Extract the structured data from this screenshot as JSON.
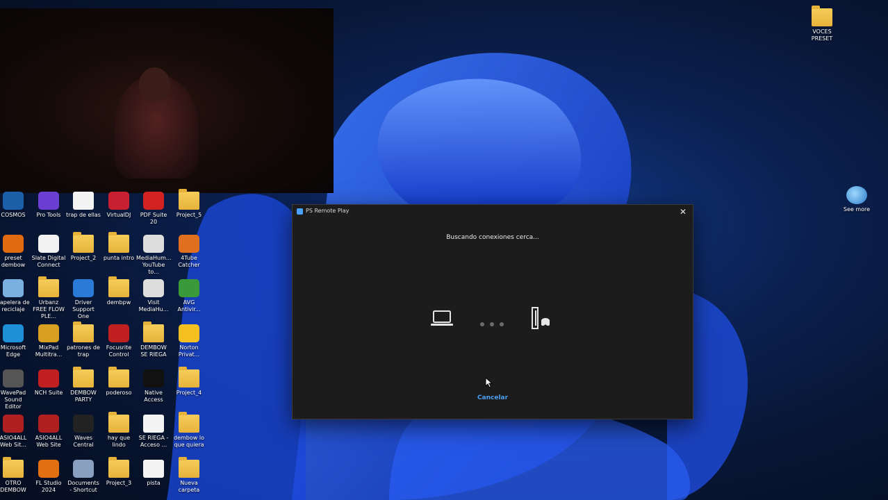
{
  "dialog": {
    "title": "PS Remote Play",
    "status_text": "Buscando conexiones cerca...",
    "cancel_label": "Cancelar",
    "icons": [
      "laptop-icon",
      "connecting-dots-icon",
      "ps5-console-icon",
      "close-icon"
    ]
  },
  "desktop_icons": {
    "top_right": [
      {
        "label": "VOCES PRESET",
        "type": "folder"
      },
      {
        "label": "See more",
        "type": "globe"
      }
    ],
    "row1": [
      {
        "label": "COSMOS",
        "type": "app",
        "color": "#1a5fa8"
      },
      {
        "label": "Pro Tools",
        "type": "app",
        "color": "#6b3fd1"
      },
      {
        "label": "trap de ellas",
        "type": "media"
      },
      {
        "label": "VirtualDJ",
        "type": "app",
        "color": "#c82030"
      },
      {
        "label": "PDF Suite 20",
        "type": "app",
        "color": "#d42222"
      },
      {
        "label": "Project_5",
        "type": "folder"
      }
    ],
    "row2": [
      {
        "label": "preset dembow",
        "type": "app",
        "color": "#e06a10"
      },
      {
        "label": "Slate Digital Connect",
        "type": "app",
        "color": "#f2f2f2"
      },
      {
        "label": "Project_2",
        "type": "folder"
      },
      {
        "label": "punta intro",
        "type": "folder"
      },
      {
        "label": "MediaHum... YouTube to...",
        "type": "app",
        "color": "#dddddd"
      },
      {
        "label": "4Tube Catcher",
        "type": "app",
        "color": "#e07020"
      }
    ],
    "row3": [
      {
        "label": "Papelera de reciclaje",
        "type": "app",
        "color": "#7ab0e0"
      },
      {
        "label": "Urbanz FREE FLOW PLE...",
        "type": "folder"
      },
      {
        "label": "Driver Support One",
        "type": "app",
        "color": "#2a7ad8"
      },
      {
        "label": "dembpw",
        "type": "folder"
      },
      {
        "label": "Visit MediaHu...",
        "type": "app",
        "color": "#dddddd"
      },
      {
        "label": "AVG Antivir...",
        "type": "app",
        "color": "#3a9a3a"
      }
    ],
    "row4": [
      {
        "label": "Microsoft Edge",
        "type": "app",
        "color": "#1e90d8"
      },
      {
        "label": "MixPad Multitra...",
        "type": "app",
        "color": "#d8a020"
      },
      {
        "label": "patrones de trap",
        "type": "folder"
      },
      {
        "label": "Focusrite Control",
        "type": "app",
        "color": "#c02020"
      },
      {
        "label": "DEMBOW SE RIEGA",
        "type": "folder"
      },
      {
        "label": "Norton Privat...",
        "type": "app",
        "color": "#f5c020"
      }
    ],
    "row5": [
      {
        "label": "WavePad Sound Editor",
        "type": "app",
        "color": "#555555"
      },
      {
        "label": "NCH Suite",
        "type": "app",
        "color": "#c02020"
      },
      {
        "label": "DEMBOW PARTY",
        "type": "folder"
      },
      {
        "label": "poderoso",
        "type": "folder"
      },
      {
        "label": "Native Access",
        "type": "app",
        "color": "#111111"
      },
      {
        "label": "Project_4",
        "type": "folder"
      }
    ],
    "row6": [
      {
        "label": "ASIO4ALL Web Sit...",
        "type": "app",
        "color": "#b02020"
      },
      {
        "label": "ASIO4ALL Web Site",
        "type": "app",
        "color": "#b02020"
      },
      {
        "label": "Waves Central",
        "type": "app",
        "color": "#222222"
      },
      {
        "label": "hay que lindo",
        "type": "folder"
      },
      {
        "label": "SE RIEGA - Acceso ...",
        "type": "media"
      },
      {
        "label": "dembow lo que quiera",
        "type": "folder"
      }
    ],
    "row7": [
      {
        "label": "OTRO DEMBOW",
        "type": "folder"
      },
      {
        "label": "FL Studio 2024",
        "type": "app",
        "color": "#e07010"
      },
      {
        "label": "Documents - Shortcut",
        "type": "app",
        "color": "#8aa0c0"
      },
      {
        "label": "Project_3",
        "type": "folder"
      },
      {
        "label": "pista",
        "type": "media"
      },
      {
        "label": "Nueva carpeta",
        "type": "folder"
      }
    ]
  },
  "webcam": {
    "label": "webcam-overlay"
  }
}
